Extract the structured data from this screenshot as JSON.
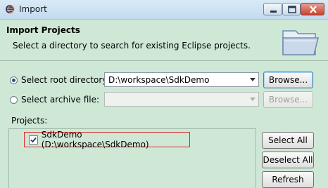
{
  "window": {
    "title": "Import"
  },
  "header": {
    "title": "Import Projects",
    "description": "Select a directory to search for existing Eclipse projects."
  },
  "root": {
    "label": "Select root directory:",
    "value": "D:\\workspace\\SdkDemo",
    "selected": true,
    "browse_label": "Browse..."
  },
  "archive": {
    "label": "Select archive file:",
    "value": "",
    "selected": false,
    "browse_label": "Browse..."
  },
  "projects": {
    "label": "Projects:",
    "items": [
      {
        "label": "SdkDemo (D:\\workspace\\SdkDemo)",
        "checked": true
      }
    ]
  },
  "actions": {
    "select_all": "Select All",
    "deselect_all": "Deselect All",
    "refresh": "Refresh"
  },
  "colors": {
    "background": "#cfe8d6",
    "highlight_border": "#d9282b"
  }
}
